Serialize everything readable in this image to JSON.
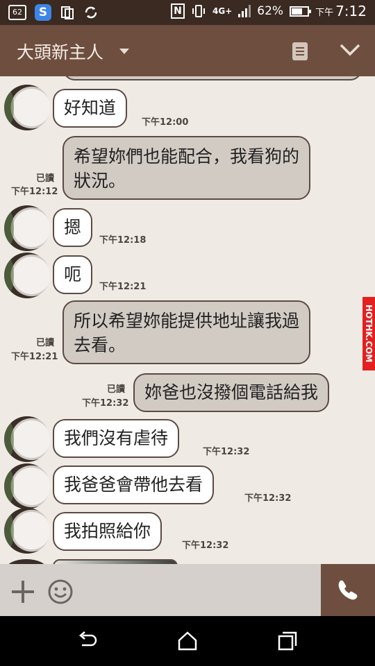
{
  "status_bar": {
    "notif_count": "62",
    "network": "4G+",
    "battery": "62%",
    "ampm": "下午",
    "time": "7:12"
  },
  "header": {
    "title": "大頭新主人"
  },
  "messages": [
    {
      "dir": "in",
      "text": "好知道",
      "time": "下午12:00"
    },
    {
      "dir": "out",
      "lines": [
        "希望妳們也能配合，我看狗的",
        "狀況。"
      ],
      "read": "已讀",
      "time": "下午12:12"
    },
    {
      "dir": "in",
      "text": "摁",
      "time": "下午12:18"
    },
    {
      "dir": "in",
      "text": "呃",
      "time": "下午12:21"
    },
    {
      "dir": "out",
      "lines": [
        "所以希望妳能提供地址讓我過",
        "去看。"
      ],
      "read": "已讀",
      "time": "下午12:21"
    },
    {
      "dir": "out",
      "text": "妳爸也沒撥個電話給我",
      "read": "已讀",
      "time": "下午12:32"
    },
    {
      "dir": "in",
      "text": "我們沒有虐待",
      "time": "下午12:32"
    },
    {
      "dir": "in",
      "text": "我爸爸會帶他去看",
      "time": "下午12:32"
    },
    {
      "dir": "in",
      "text": "我拍照給你",
      "time": "下午12:32"
    }
  ],
  "watermark": "HOTHK.COM",
  "icons": {
    "plus": "plus-icon",
    "emoji": "emoji-icon",
    "call": "phone-icon",
    "back": "back-icon",
    "home": "home-icon",
    "recents": "recents-icon"
  }
}
